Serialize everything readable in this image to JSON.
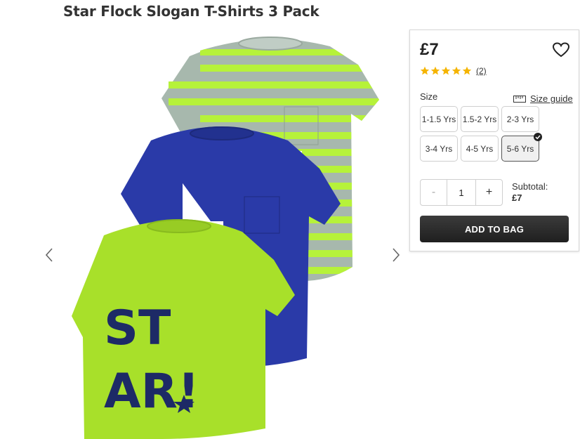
{
  "product": {
    "title": "Star Flock Slogan T-Shirts 3 Pack"
  },
  "pricing": {
    "price": "£7"
  },
  "rating": {
    "stars": 5,
    "review_count": "(2)"
  },
  "size": {
    "label": "Size",
    "guide_label": "Size guide",
    "options": [
      "1-1.5 Yrs",
      "1.5-2 Yrs",
      "2-3 Yrs",
      "3-4 Yrs",
      "4-5 Yrs",
      "5-6 Yrs"
    ],
    "selected": "5-6 Yrs"
  },
  "quantity": {
    "minus": "-",
    "value": "1",
    "plus": "+"
  },
  "subtotal": {
    "label": "Subtotal:",
    "amount": "£7"
  },
  "cart": {
    "add_label": "ADD TO BAG"
  },
  "colors": {
    "star": "#f5b400",
    "button": "#2a2a2a",
    "lime": "#a8e02a",
    "navy": "#2a3aa8",
    "stripe_grey": "#a7b8ad"
  },
  "icons": [
    "chevron-left-icon",
    "chevron-right-icon",
    "heart-icon",
    "star-icon",
    "ruler-icon",
    "check-icon"
  ]
}
